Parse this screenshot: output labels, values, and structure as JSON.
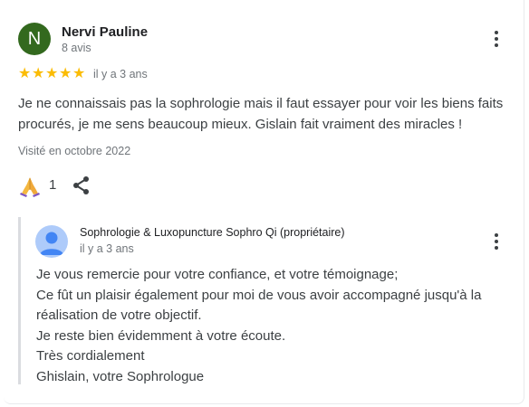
{
  "review": {
    "avatar_letter": "N",
    "avatar_color": "#33691e",
    "author": "Nervi Pauline",
    "review_count": "8 avis",
    "rating": 5,
    "relative_date": "il y a 3 ans",
    "text": "Je ne connaissais pas la sophrologie mais il faut essayer pour voir les biens faits procurés, je me sens beaucoup mieux. Gislain fait vraiment des miracles !",
    "visited": "Visité en octobre 2022",
    "reaction_icon": "folded-hands-emoji",
    "reaction_count": "1",
    "share_icon": "share-icon",
    "menu_icon": "more-vert-icon"
  },
  "owner_reply": {
    "name": "Sophrologie & Luxopuncture Sophro Qi (propriétaire)",
    "relative_date": "il y a 3 ans",
    "avatar_icon": "person-icon",
    "avatar_color": "#aecbfa",
    "menu_icon": "more-vert-icon",
    "lines": [
      "Je vous remercie pour votre confiance, et votre témoignage;",
      "Ce fût un plaisir également pour moi de vous avoir accompagné jusqu'à la",
      "réalisation de votre objectif.",
      "Je reste bien évidemment à votre écoute.",
      "Très cordialement",
      "Ghislain, votre Sophrologue"
    ]
  },
  "colors": {
    "star": "#fbbc04",
    "text": "#3c4043",
    "muted": "#70757a"
  }
}
